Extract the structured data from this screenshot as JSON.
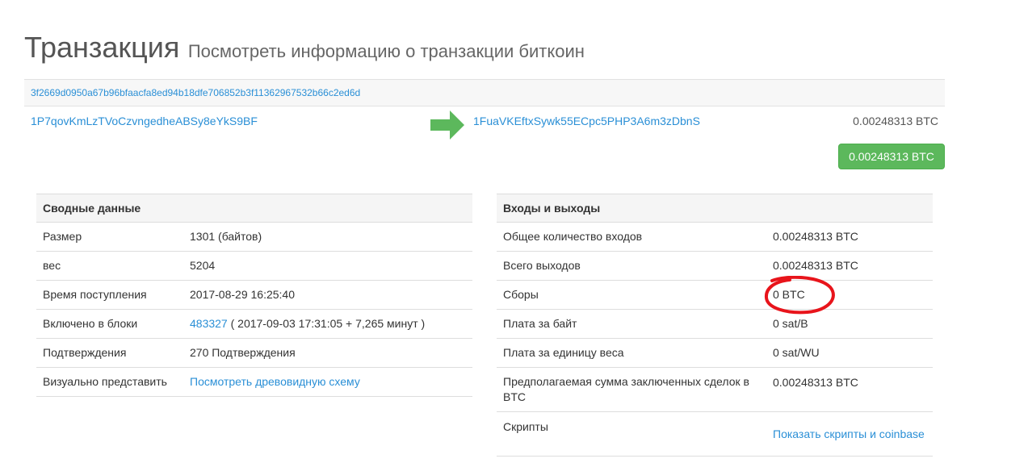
{
  "page": {
    "title": "Транзакция",
    "subtitle": "Посмотреть информацию о транзакции биткоин"
  },
  "transaction": {
    "hash": "3f2669d0950a67b96bfaacfa8ed94b18dfe706852b3f11362967532b66c2ed6d",
    "from_address": "1P7qovKmLzTVoCzvngedheABSy8eYkS9BF",
    "to_address": "1FuaVKEftxSywk55ECpc5PHP3A6m3zDbnS",
    "output_amount": "0.00248313 BTC",
    "total_button": "0.00248313 BTC"
  },
  "summary": {
    "header": "Сводные данные",
    "size_label": "Размер",
    "size_value": "1301 (байтов)",
    "weight_label": "вес",
    "weight_value": "5204",
    "received_label": "Время поступления",
    "received_value": "2017-08-29 16:25:40",
    "included_label": "Включено в блоки",
    "block_link": "483327",
    "block_time": " ( 2017-09-03 17:31:05 + 7,265 минут )",
    "confirmations_label": "Подтверждения",
    "confirmations_value": "270 Подтверждения",
    "visualize_label": "Визуально представить",
    "visualize_link": "Посмотреть древовидную схему"
  },
  "io": {
    "header": "Входы и выходы",
    "total_inputs_label": "Общее количество входов",
    "total_inputs_value": "0.00248313 BTC",
    "total_outputs_label": "Всего выходов",
    "total_outputs_value": "0.00248313 BTC",
    "fees_label": "Сборы",
    "fees_value": "0 BTC",
    "fee_per_byte_label": "Плата за байт",
    "fee_per_byte_value": "0 sat/B",
    "fee_per_weight_label": "Плата за единицу веса",
    "fee_per_weight_value": "0 sat/WU",
    "estimated_label": "Предполагаемая сумма заключенных сделок в BTC",
    "estimated_value": "0.00248313 BTC",
    "scripts_label": "Скрипты",
    "scripts_link": "Показать скрипты и coinbase"
  },
  "colors": {
    "link": "#2a8fd6",
    "button_green": "#5cb85c",
    "arrow_green": "#5cb85c",
    "annotation_red": "#e8141b"
  },
  "icons": {
    "arrow": "arrow-right-icon"
  }
}
